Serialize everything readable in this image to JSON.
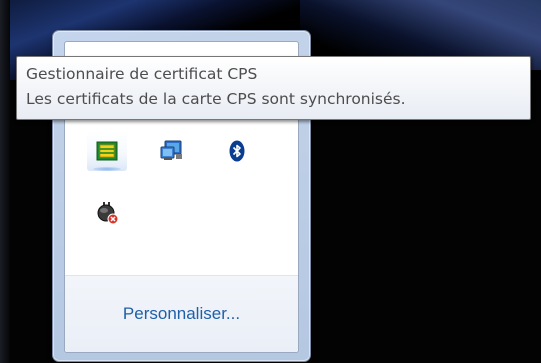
{
  "tooltip": {
    "title": "Gestionnaire de certificat CPS",
    "message": "Les certificats de la carte CPS sont synchronisés."
  },
  "tray": {
    "icons": [
      {
        "name": "cps-certificate-manager-icon",
        "selected": true
      },
      {
        "name": "network-monitor-icon",
        "selected": false
      },
      {
        "name": "bluetooth-icon",
        "selected": false
      },
      {
        "name": "power-error-icon",
        "selected": false
      }
    ],
    "customize_label": "Personnaliser..."
  },
  "colors": {
    "link": "#1f5fa8",
    "bluetooth": "#0b3d91",
    "error": "#d9362b"
  }
}
